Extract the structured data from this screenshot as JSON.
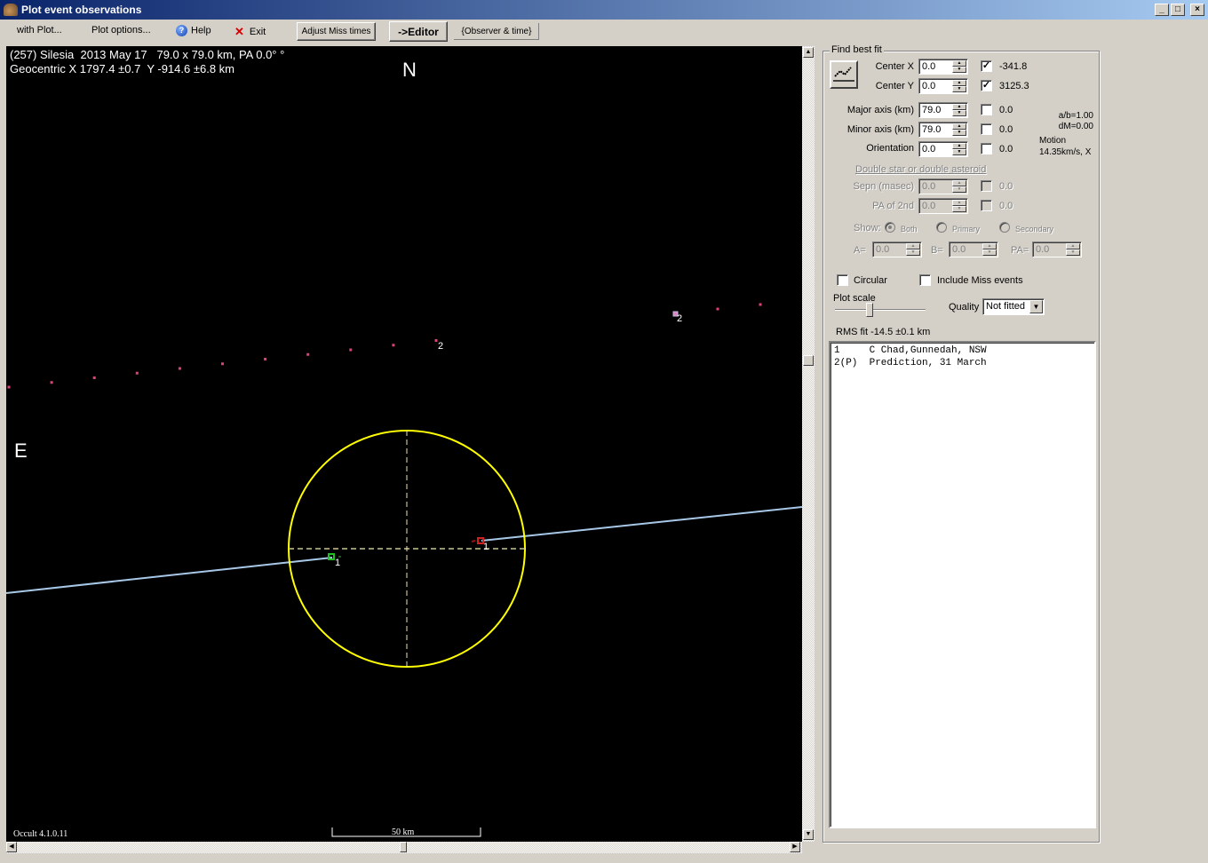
{
  "window": {
    "title": "Plot event observations",
    "controls": [
      "minimize",
      "maximize",
      "close"
    ]
  },
  "menu": {
    "with_plot": "with Plot...",
    "plot_options": "Plot options...",
    "help": "Help",
    "exit": "Exit",
    "adjust_miss_times": "Adjust Miss times",
    "editor": "->Editor",
    "observer_time": "{Observer & time}"
  },
  "plot": {
    "header_line1": "(257) Silesia  2013 May 17   79.0 x 79.0 km, PA 0.0° °",
    "header_line2": "Geocentric X 1797.4 ±0.7  Y -914.6 ±6.8 km",
    "north_label": "N",
    "east_label": "E",
    "version": "Occult 4.1.0.11",
    "scale_label": "50 km",
    "chord_label_1a": "1",
    "chord_label_1b": "1",
    "prediction_label_a": "2",
    "prediction_label_b": "2",
    "colors": {
      "ellipse": "#ffff00",
      "chord": "#a8c8e8",
      "axes": "#c8c890",
      "prediction_dots": "#e0407a",
      "disappear": "#20c020",
      "reappear": "#d02020"
    }
  },
  "fit_panel": {
    "title": "Find best fit",
    "center_x": {
      "label": "Center X",
      "value": "0.0",
      "checked": true,
      "result": "-341.8"
    },
    "center_y": {
      "label": "Center Y",
      "value": "0.0",
      "checked": true,
      "result": "3125.3"
    },
    "major_axis": {
      "label": "Major axis (km)",
      "value": "79.0",
      "checked": false,
      "result": "0.0"
    },
    "minor_axis": {
      "label": "Minor axis (km)",
      "value": "79.0",
      "checked": false,
      "result": "0.0"
    },
    "orientation": {
      "label": "Orientation",
      "value": "0.0",
      "checked": false,
      "result": "0.0"
    },
    "ab_ratio": "a/b=1.00",
    "dm": "dM=0.00",
    "motion_label": "Motion",
    "motion_value": "14.35km/s, X",
    "double_title": "Double star  or  double asteroid",
    "sepn": {
      "label": "Sepn (masec)",
      "value": "0.0",
      "result": "0.0"
    },
    "pa2nd": {
      "label": "PA of 2nd",
      "value": "0.0",
      "result": "0.0"
    },
    "show_label": "Show:",
    "show_options": [
      "Both",
      "Primary",
      "Secondary"
    ],
    "show_selected": "Both",
    "a_label": "A=",
    "a_value": "0.0",
    "b_label": "B=",
    "b_value": "0.0",
    "pa_label": "PA=",
    "pa_value": "0.0",
    "circular_label": "Circular",
    "include_miss_label": "Include Miss events",
    "plot_scale_label": "Plot scale",
    "quality_label": "Quality",
    "quality_value": "Not fitted",
    "rms_fit": "RMS fit -14.5 ±0.1 km",
    "observers": [
      "1     C Chad,Gunnedah, NSW",
      "2(P)  Prediction, 31 March"
    ]
  }
}
